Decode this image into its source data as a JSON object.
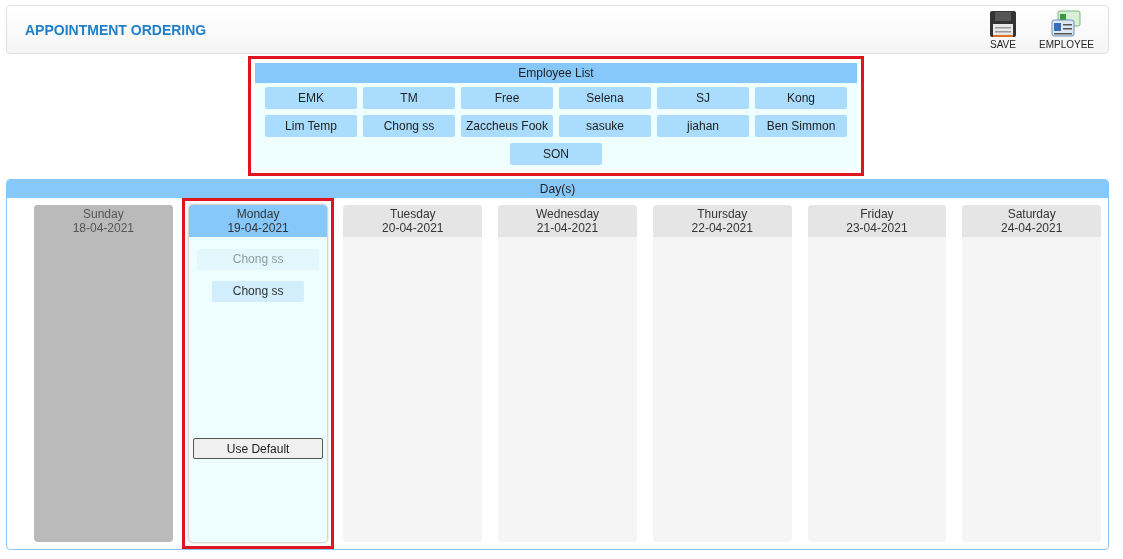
{
  "header": {
    "title": "APPOINTMENT ORDERING",
    "actions": [
      {
        "kind": "save",
        "label": "SAVE"
      },
      {
        "kind": "employee",
        "label": "EMPLOYEE"
      }
    ]
  },
  "employee_list": {
    "title": "Employee List",
    "highlighted": true,
    "employees": [
      "EMK",
      "TM",
      "Free",
      "Selena",
      "SJ",
      "Kong",
      "Lim Temp",
      "Chong ss",
      "Zaccheus Fook",
      "sasuke",
      "jiahan",
      "Ben Simmon",
      "SON"
    ]
  },
  "days_panel": {
    "title": "Day(s)",
    "days": [
      {
        "name": "Sunday",
        "date": "18-04-2021",
        "off": true,
        "selected": false,
        "highlighted": false
      },
      {
        "name": "Monday",
        "date": "19-04-2021",
        "off": false,
        "selected": true,
        "highlighted": true,
        "assigned": [
          {
            "name": "Chong ss",
            "faded": true
          },
          {
            "name": "Chong ss",
            "faded": false
          }
        ],
        "button": "Use Default"
      },
      {
        "name": "Tuesday",
        "date": "20-04-2021",
        "off": false,
        "selected": false,
        "highlighted": false
      },
      {
        "name": "Wednesday",
        "date": "21-04-2021",
        "off": false,
        "selected": false,
        "highlighted": false
      },
      {
        "name": "Thursday",
        "date": "22-04-2021",
        "off": false,
        "selected": false,
        "highlighted": false
      },
      {
        "name": "Friday",
        "date": "23-04-2021",
        "off": false,
        "selected": false,
        "highlighted": false
      },
      {
        "name": "Saturday",
        "date": "24-04-2021",
        "off": false,
        "selected": false,
        "highlighted": false
      }
    ]
  }
}
